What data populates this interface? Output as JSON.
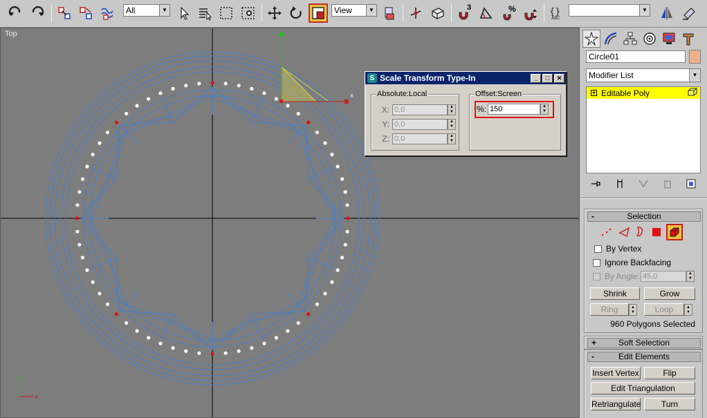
{
  "toolbar": {
    "selection_filter": "All",
    "ref_coord": "View",
    "named_selection": "",
    "snap_badge": "3",
    "angle_snap_badge": "%"
  },
  "viewport": {
    "label": "Top",
    "gizmo_x_label": "x",
    "axis_y": "y",
    "axis_x": "x"
  },
  "dialog": {
    "title": "Scale Transform Type-In",
    "absolute_label": "Absolute:Local",
    "offset_label": "Offset:Screen",
    "x_label": "X:",
    "y_label": "Y:",
    "z_label": "Z:",
    "x_value": "0,0",
    "y_value": "0,0",
    "z_value": "0,0",
    "percent_label": "%:",
    "percent_value": "150"
  },
  "panel": {
    "object_name": "Circle01",
    "object_color": "#f0b088",
    "modifier_list": "Modifier List",
    "stack_item": "Editable Poly",
    "selection": {
      "header": "Selection",
      "by_vertex": "By Vertex",
      "ignore_backfacing": "Ignore Backfacing",
      "by_angle": "By Angle:",
      "by_angle_value": "45,0",
      "shrink": "Shrink",
      "grow": "Grow",
      "ring": "Ring",
      "loop": "Loop",
      "status": "960 Polygons Selected"
    },
    "soft_selection": "Soft Selection",
    "edit_elements": {
      "header": "Edit Elements",
      "insert_vertex": "Insert Vertex",
      "flip": "Flip",
      "edit_triangulation": "Edit Triangulation",
      "retriangulate": "Retriangulate",
      "turn": "Turn"
    }
  },
  "colors": {
    "viewport_bg": "#7d7d7d",
    "wire": "#4a7fc8",
    "active_tool": "#f0c040",
    "stack_highlight": "#ffff00",
    "title_bar": "#0a246a"
  }
}
